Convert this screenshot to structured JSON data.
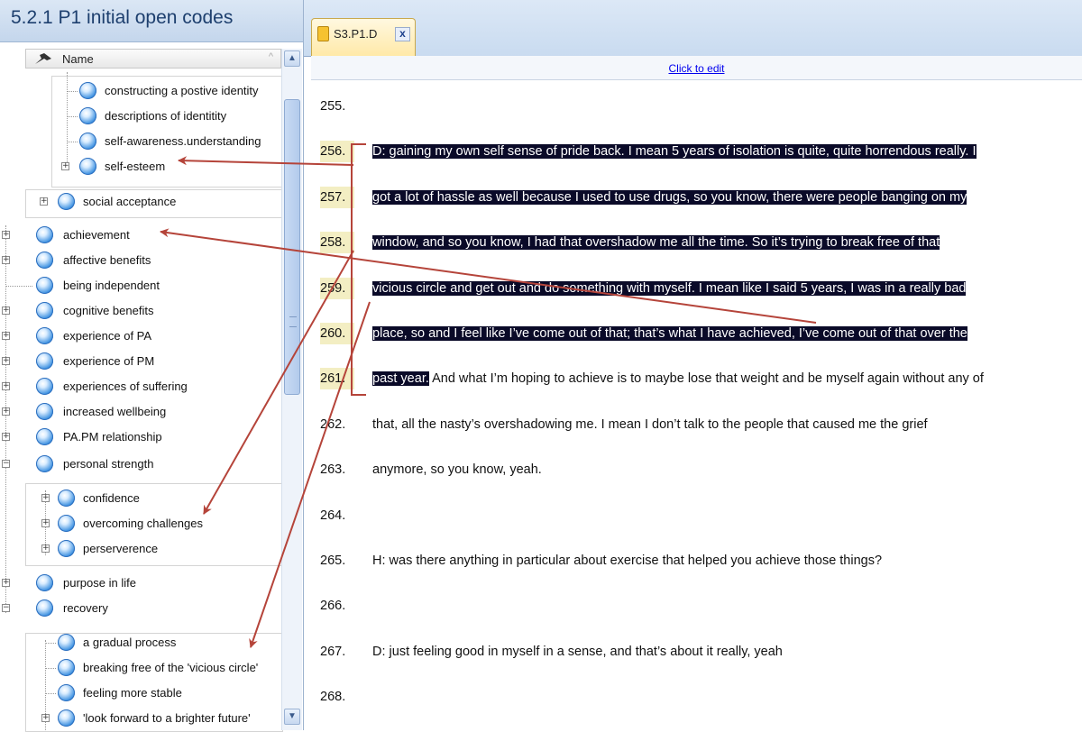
{
  "codebook": {
    "title": "5.2.1 P1 initial open codes",
    "column_header": "Name",
    "sort_indicator": "^",
    "items": [
      {
        "label": "constructing a postive identity",
        "expander": ""
      },
      {
        "label": "descriptions of identitity",
        "expander": ""
      },
      {
        "label": "self-awareness.understanding",
        "expander": ""
      },
      {
        "label": "self-esteem",
        "expander": "+"
      },
      {
        "label": "social acceptance",
        "expander": "+"
      },
      {
        "label": "achievement",
        "expander": "+"
      },
      {
        "label": "affective benefits",
        "expander": "+"
      },
      {
        "label": "being independent",
        "expander": ""
      },
      {
        "label": "cognitive benefits",
        "expander": "+"
      },
      {
        "label": "experience of PA",
        "expander": "+"
      },
      {
        "label": "experience of PM",
        "expander": "+"
      },
      {
        "label": "experiences of suffering",
        "expander": "+"
      },
      {
        "label": "increased wellbeing",
        "expander": "+"
      },
      {
        "label": "PA.PM relationship",
        "expander": "+"
      },
      {
        "label": "personal strength",
        "expander": "−"
      },
      {
        "label": "confidence",
        "expander": "+"
      },
      {
        "label": "overcoming challenges",
        "expander": "+"
      },
      {
        "label": "perserverence",
        "expander": "+"
      },
      {
        "label": "purpose in life",
        "expander": "+"
      },
      {
        "label": "recovery",
        "expander": "−"
      },
      {
        "label": "a gradual process",
        "expander": ""
      },
      {
        "label": "breaking free of the 'vicious circle'",
        "expander": ""
      },
      {
        "label": "feeling more stable",
        "expander": ""
      },
      {
        "label": "'look forward to a brighter future'",
        "expander": "+"
      }
    ]
  },
  "scrollbar": {
    "up": "▲",
    "down": "▼"
  },
  "document": {
    "tab_title": "S3.P1.D",
    "tab_close": "x",
    "edit_link": "Click to edit",
    "lines": [
      {
        "num": "255.",
        "text": "",
        "coded": false,
        "selected": "",
        "rest": ""
      },
      {
        "num": "256.",
        "coded": true,
        "selected": "D: gaining my own self sense of pride back.  I mean 5 years of isolation is quite, quite horrendous really.  I",
        "rest": ""
      },
      {
        "num": "257.",
        "coded": true,
        "selected": "got a lot of hassle as well because I used to use drugs, so you know, there were people banging on my",
        "rest": ""
      },
      {
        "num": "258.",
        "coded": true,
        "selected": "window, and so you know, I had that overshadow me all the time.  So it’s trying to break free of that",
        "rest": ""
      },
      {
        "num": "259.",
        "coded": true,
        "selected": "vicious circle and get out and do something with myself.  I mean like I said 5 years, I was in a really bad",
        "rest": ""
      },
      {
        "num": "260.",
        "coded": true,
        "selected": "place, so and I feel like I’ve come out of that; that’s what I have achieved, I’ve come out of that over the",
        "rest": ""
      },
      {
        "num": "261.",
        "coded": true,
        "selected": "past year.",
        "rest": "  And what I’m hoping to achieve is to maybe lose that weight and be myself again without any of"
      },
      {
        "num": "262.",
        "coded": false,
        "selected": "",
        "rest": "that, all the nasty’s overshadowing me.  I mean I don’t talk to the people that caused me the grief"
      },
      {
        "num": "263.",
        "coded": false,
        "selected": "",
        "rest": "anymore, so you know, yeah."
      },
      {
        "num": "264.",
        "coded": false,
        "selected": "",
        "rest": ""
      },
      {
        "num": "265.",
        "coded": false,
        "selected": "",
        "rest": "H: was there anything in particular about exercise that helped you achieve those things?"
      },
      {
        "num": "266.",
        "coded": false,
        "selected": "",
        "rest": ""
      },
      {
        "num": "267.",
        "coded": false,
        "selected": "",
        "rest": "D: just feeling good in myself in a sense, and that’s about it really, yeah"
      },
      {
        "num": "268.",
        "coded": false,
        "selected": "",
        "rest": ""
      }
    ]
  },
  "colors": {
    "selection": "#0a0a28",
    "coded_line_number": "#f3eec3",
    "annotation_arrow": "#b5443a",
    "title_text": "#1d3f6e"
  }
}
